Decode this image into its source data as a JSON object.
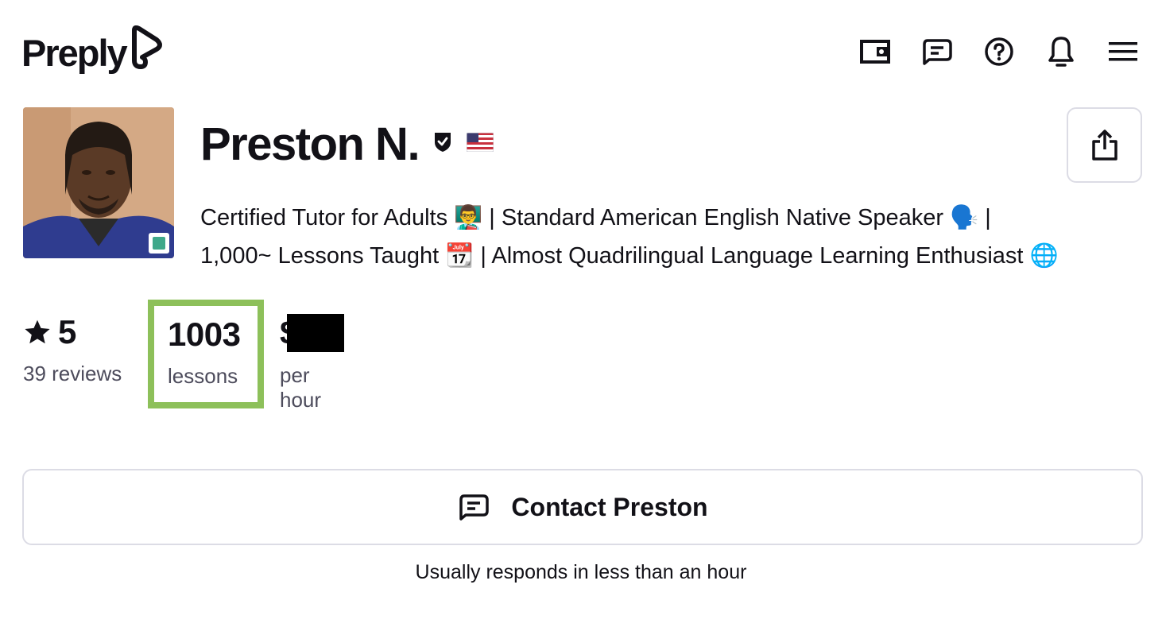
{
  "brand": {
    "name": "Preply"
  },
  "header": {
    "icons": [
      "wallet-icon",
      "messages-icon",
      "help-icon",
      "notifications-icon",
      "menu-icon"
    ]
  },
  "tutor": {
    "name": "Preston N.",
    "verified_icon": "verified-shield-icon",
    "flag_icon": "us-flag-icon",
    "online": true,
    "headline_line1": "Certified Tutor for Adults 👨‍🏫 | Standard American English Native Speaker 🗣️ |",
    "headline_line2": "1,000~ Lessons Taught 📆 | Almost Quadrilingual Language Learning Enthusiast 🌐"
  },
  "stats": {
    "rating": "5",
    "reviews_label": "39 reviews",
    "lessons_value": "1003",
    "lessons_label": "lessons",
    "price_prefix": "$",
    "price_label": "per hour"
  },
  "actions": {
    "contact_label": "Contact Preston",
    "response_text": "Usually responds in less than an hour"
  },
  "colors": {
    "highlight_border": "#8dc05a",
    "online_status": "#3fa88a",
    "text_primary": "#121117",
    "text_secondary": "#4d4c5c",
    "border": "#dcdce5"
  }
}
